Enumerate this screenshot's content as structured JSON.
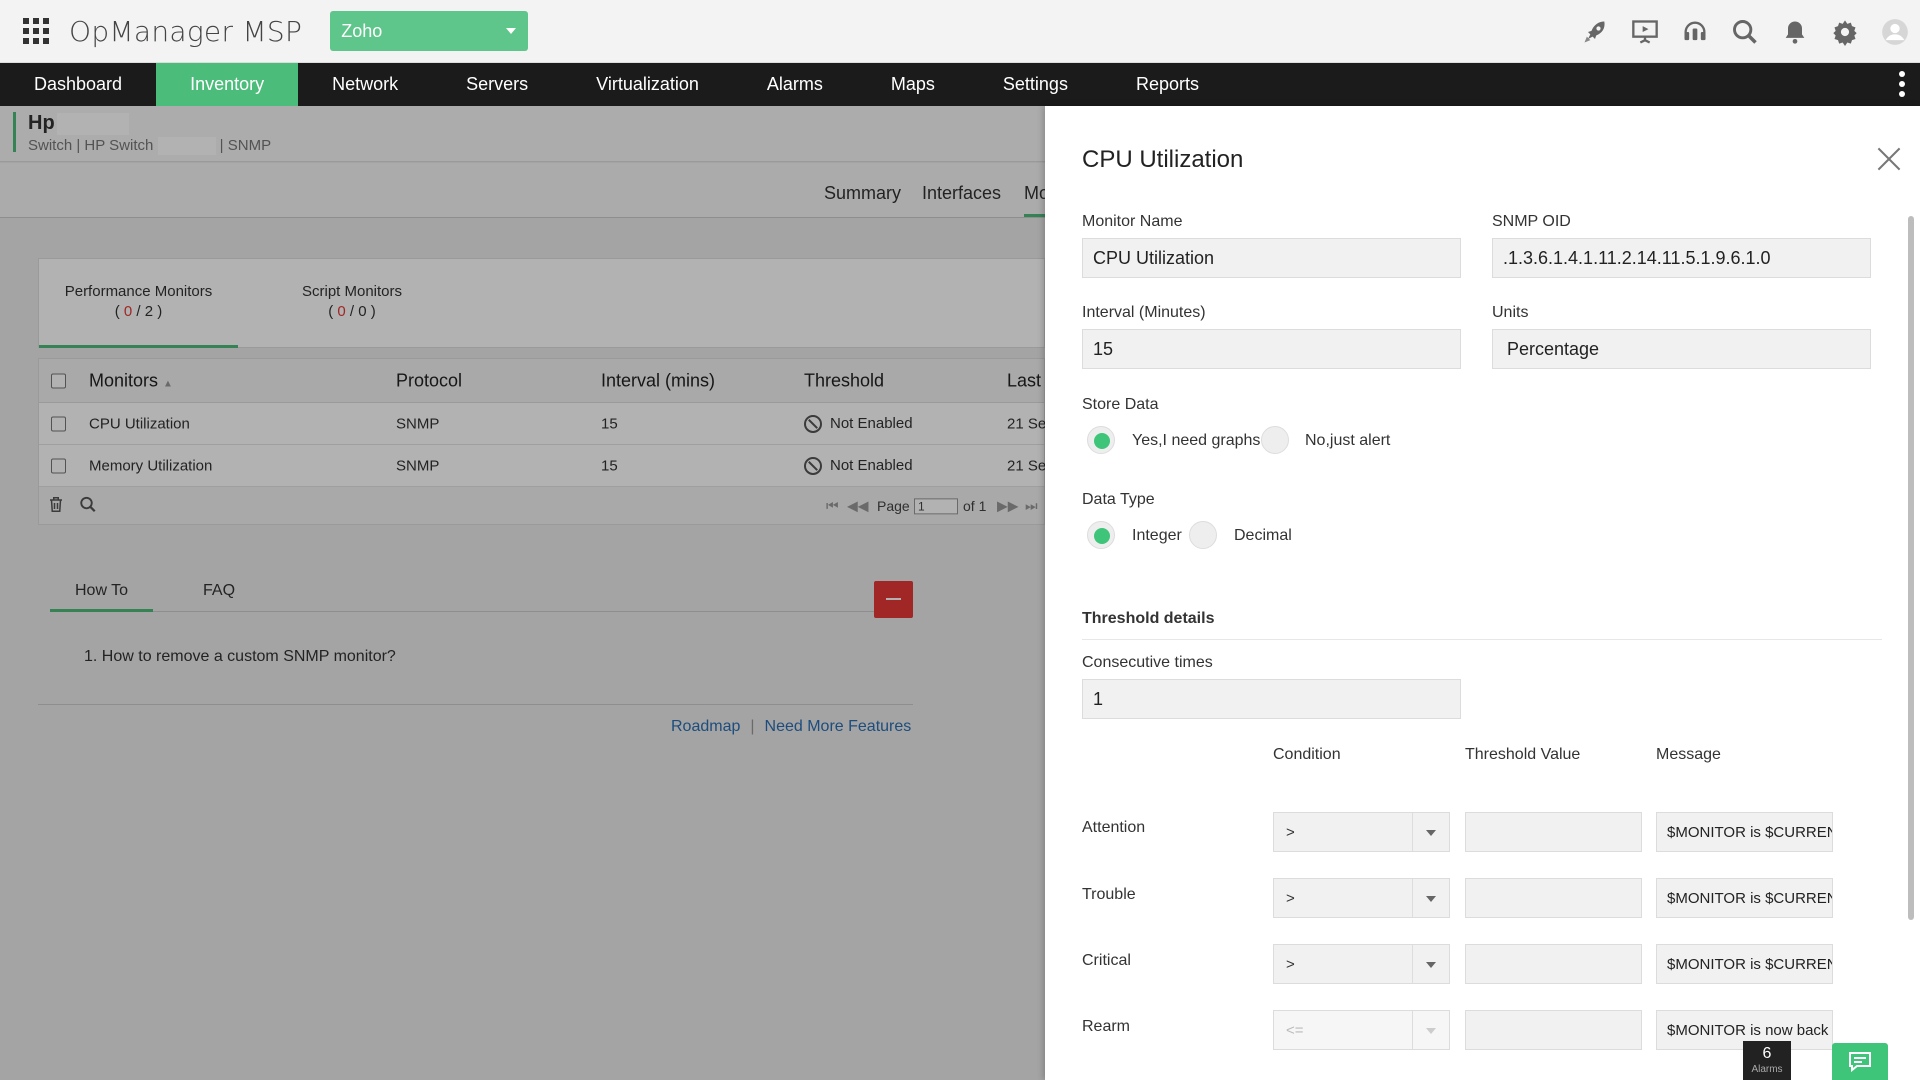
{
  "header": {
    "app_title": "OpManager MSP",
    "org_select": "Zoho",
    "icons": [
      "apps-grid-icon",
      "rocket-icon",
      "presentation-icon",
      "headset-icon",
      "search-icon",
      "bell-icon",
      "gear-icon",
      "user-avatar-icon"
    ]
  },
  "nav": {
    "items": [
      {
        "label": "Dashboard"
      },
      {
        "label": "Inventory",
        "active": true
      },
      {
        "label": "Network"
      },
      {
        "label": "Servers"
      },
      {
        "label": "Virtualization"
      },
      {
        "label": "Alarms"
      },
      {
        "label": "Maps"
      },
      {
        "label": "Settings"
      },
      {
        "label": "Reports"
      }
    ]
  },
  "device": {
    "name": "Hp",
    "sub_prefix": "Switch | HP Switch",
    "sub_suffix": "| SNMP"
  },
  "sub_tabs": [
    "Summary",
    "Interfaces",
    "Mo"
  ],
  "monitor_tabs": [
    {
      "label": "Performance Monitors",
      "open": "( ",
      "count": "0",
      "sep": " / ",
      "total": "2",
      "close": " )"
    },
    {
      "label": "Script Monitors",
      "open": "( ",
      "count": "0",
      "sep": " / ",
      "total": "0",
      "close": " )"
    }
  ],
  "table": {
    "headers": [
      "Monitors",
      "Protocol",
      "Interval (mins)",
      "Threshold",
      "Last I"
    ],
    "rows": [
      {
        "monitor": "CPU Utilization",
        "protocol": "SNMP",
        "interval": "15",
        "threshold": "Not Enabled",
        "last": "21 Se"
      },
      {
        "monitor": "Memory Utilization",
        "protocol": "SNMP",
        "interval": "15",
        "threshold": "Not Enabled",
        "last": "21 Se"
      }
    ],
    "pager": {
      "page_label": "Page",
      "page_value": "1",
      "of_label": "of 1"
    }
  },
  "help": {
    "tabs": [
      "How To",
      "FAQ"
    ],
    "item": "1. How to remove a custom SNMP monitor?",
    "links": [
      "Roadmap",
      "Need More Features"
    ],
    "link_sep": "|"
  },
  "panel": {
    "title": "CPU Utilization",
    "monitor_name_label": "Monitor Name",
    "monitor_name_value": "CPU Utilization",
    "snmp_oid_label": "SNMP OID",
    "snmp_oid_value": ".1.3.6.1.4.1.11.2.14.11.5.1.9.6.1.0",
    "interval_label": "Interval (Minutes)",
    "interval_value": "15",
    "units_label": "Units",
    "units_value": "Percentage",
    "store_data_label": "Store Data",
    "store_data_options": [
      {
        "label": "Yes,I need graphs",
        "selected": true
      },
      {
        "label": "No,just alert",
        "selected": false
      }
    ],
    "data_type_label": "Data Type",
    "data_type_options": [
      {
        "label": "Integer",
        "selected": true
      },
      {
        "label": "Decimal",
        "selected": false
      }
    ],
    "threshold_heading": "Threshold details",
    "consecutive_label": "Consecutive times",
    "consecutive_value": "1",
    "columns": [
      "Condition",
      "Threshold Value",
      "Message"
    ],
    "rows": [
      {
        "label": "Attention",
        "condition": ">",
        "threshold": "",
        "message": "$MONITOR is $CURRENT",
        "disabled": false
      },
      {
        "label": "Trouble",
        "condition": ">",
        "threshold": "",
        "message": "$MONITOR is $CURRENT",
        "disabled": false
      },
      {
        "label": "Critical",
        "condition": ">",
        "threshold": "",
        "message": "$MONITOR is $CURRENT",
        "disabled": false
      },
      {
        "label": "Rearm",
        "condition": "<=",
        "threshold": "",
        "message": "$MONITOR is now back",
        "disabled": true
      }
    ]
  },
  "footer": {
    "alarms_count": "6",
    "alarms_label": "Alarms"
  },
  "colors": {
    "accent_green": "#4cbc7a",
    "org_green": "#5ec68a",
    "nav_bg": "#1b1b1b",
    "danger_red": "#e53935",
    "link_blue": "#2b6fb3"
  }
}
